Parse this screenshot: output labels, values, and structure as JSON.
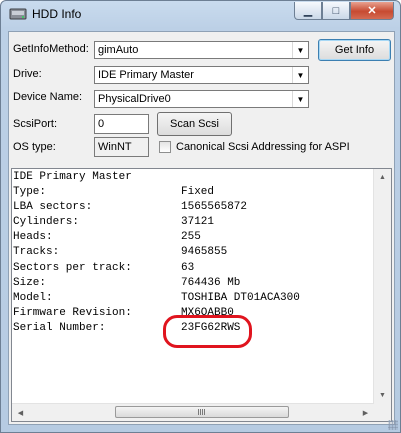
{
  "window": {
    "title": "HDD Info",
    "icons": {
      "app": "hdd-app-icon",
      "minimize": "minimize-icon",
      "maximize": "maximize-icon",
      "close": "close-icon"
    },
    "glyphs": {
      "minimize": "▁",
      "maximize": "□",
      "close": "✕"
    }
  },
  "form": {
    "getinfo_method": {
      "label": "GetInfoMethod:",
      "value": "gimAuto"
    },
    "drive": {
      "label": "Drive:",
      "value": "IDE Primary Master"
    },
    "device_name": {
      "label": "Device Name:",
      "value": "PhysicalDrive0"
    },
    "scsi_port": {
      "label": "ScsiPort:",
      "value": "0"
    },
    "os_type": {
      "label": "OS type:",
      "value": "WinNT"
    },
    "get_info_button": "Get Info",
    "scan_scsi_button": "Scan Scsi",
    "canonical_checkbox": {
      "label": "Canonical Scsi Addressing for ASPI",
      "checked": false
    }
  },
  "output": {
    "header": "IDE Primary Master",
    "rows": [
      {
        "key": "Type:",
        "value": "Fixed"
      },
      {
        "key": "LBA sectors:",
        "value": "1565565872"
      },
      {
        "key": "Cylinders:",
        "value": "37121"
      },
      {
        "key": "Heads:",
        "value": "255"
      },
      {
        "key": "Tracks:",
        "value": "9465855"
      },
      {
        "key": "Sectors per track:",
        "value": "63"
      },
      {
        "key": "Size:",
        "value": "764436 Mb"
      },
      {
        "key": "Model:",
        "value": "TOSHIBA DT01ACA300"
      },
      {
        "key": "Firmware Revision:",
        "value": "MX6OABB0"
      },
      {
        "key": "Serial Number:",
        "value": "23FG62RWS"
      }
    ]
  },
  "annotation": {
    "color": "#e0141e",
    "target": "serial-number-value"
  }
}
